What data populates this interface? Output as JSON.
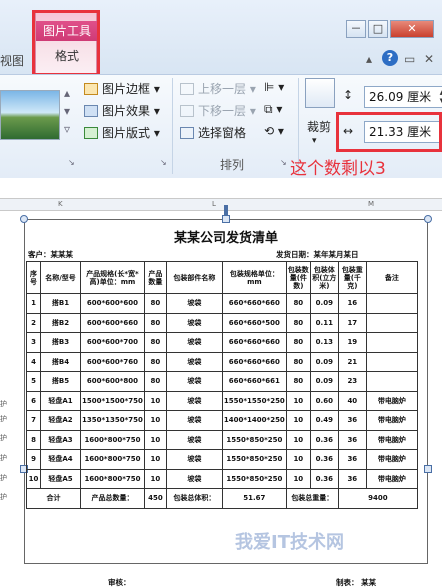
{
  "ribbon": {
    "context_group": "图片工具",
    "context_tab": "格式",
    "left_tab": "视图",
    "window_buttons": [
      "－",
      "□",
      "✕"
    ],
    "help": "?",
    "adjust_group": {
      "items": [
        {
          "label": "图片边框",
          "icon": "picture-border-icon",
          "arrow": "▾"
        },
        {
          "label": "图片效果",
          "icon": "picture-effects-icon",
          "arrow": "▾"
        },
        {
          "label": "图片版式",
          "icon": "picture-layout-icon",
          "arrow": "▾"
        }
      ]
    },
    "arrange_group": {
      "label": "排列",
      "items": [
        {
          "label": "上移一层",
          "disabled": true
        },
        {
          "label": "下移一层",
          "disabled": true
        },
        {
          "label": "选择窗格",
          "disabled": false
        }
      ]
    },
    "size_group": {
      "crop_label": "裁剪",
      "height_value": "26.09 厘米",
      "width_value": "21.33 厘米"
    },
    "annotation": "这个数剩以3"
  },
  "sheet": {
    "ruler_labels": [
      "K",
      "L",
      "M"
    ],
    "title": "某某公司发货清单",
    "customer_label": "客户：",
    "customer_value": "某某某",
    "ship_date_label": "发货日期：",
    "ship_date_value": "某年某月某日",
    "headers": [
      "序号",
      "名称/型号",
      "产品规格(长*宽*高)单位：mm",
      "产品数量",
      "包装部件名称",
      "包装规格单位：mm",
      "包装数量(件数)",
      "包装体积(立方米)",
      "包装重量(千克)",
      "备注"
    ],
    "rows": [
      [
        "1",
        "搭B1",
        "600*600*600",
        "80",
        "坡袋",
        "660*660*660",
        "80",
        "0.09",
        "16",
        ""
      ],
      [
        "2",
        "搭B2",
        "600*600*660",
        "80",
        "坡袋",
        "660*660*500",
        "80",
        "0.11",
        "17",
        ""
      ],
      [
        "3",
        "搭B3",
        "600*600*700",
        "80",
        "坡袋",
        "660*660*660",
        "80",
        "0.13",
        "19",
        ""
      ],
      [
        "4",
        "搭B4",
        "600*600*760",
        "80",
        "坡袋",
        "660*660*660",
        "80",
        "0.09",
        "21",
        ""
      ],
      [
        "5",
        "搭B5",
        "600*600*800",
        "80",
        "坡袋",
        "660*660*661",
        "80",
        "0.09",
        "23",
        ""
      ],
      [
        "6",
        "轻盘A1",
        "1500*1500*750",
        "10",
        "坡袋",
        "1550*1550*250",
        "10",
        "0.60",
        "40",
        "带电脑炉"
      ],
      [
        "7",
        "轻盘A2",
        "1350*1350*750",
        "10",
        "坡袋",
        "1400*1400*250",
        "10",
        "0.49",
        "36",
        "带电脑炉"
      ],
      [
        "8",
        "轻盘A3",
        "1600*800*750",
        "10",
        "坡袋",
        "1550*850*250",
        "10",
        "0.36",
        "36",
        "带电脑炉"
      ],
      [
        "9",
        "轻盘A4",
        "1600*800*750",
        "10",
        "坡袋",
        "1550*850*250",
        "10",
        "0.36",
        "36",
        "带电脑炉"
      ],
      [
        "10",
        "轻盘A5",
        "1600*800*750",
        "10",
        "坡袋",
        "1550*850*250",
        "10",
        "0.36",
        "36",
        "带电脑炉"
      ]
    ],
    "totals": {
      "label": "合计",
      "qty_label": "产品总数量：",
      "qty_value": "450",
      "vol_label": "包装总体积：",
      "vol_value": "51.67",
      "weight_label": "包装总重量：",
      "weight_value": "9400"
    },
    "review_label": "审核：",
    "maker_label": "制表：",
    "maker_value": "某某",
    "left_stub": [
      "护",
      "护",
      "护",
      "护",
      "护",
      "护"
    ]
  },
  "watermark": "我爱IT技术网"
}
